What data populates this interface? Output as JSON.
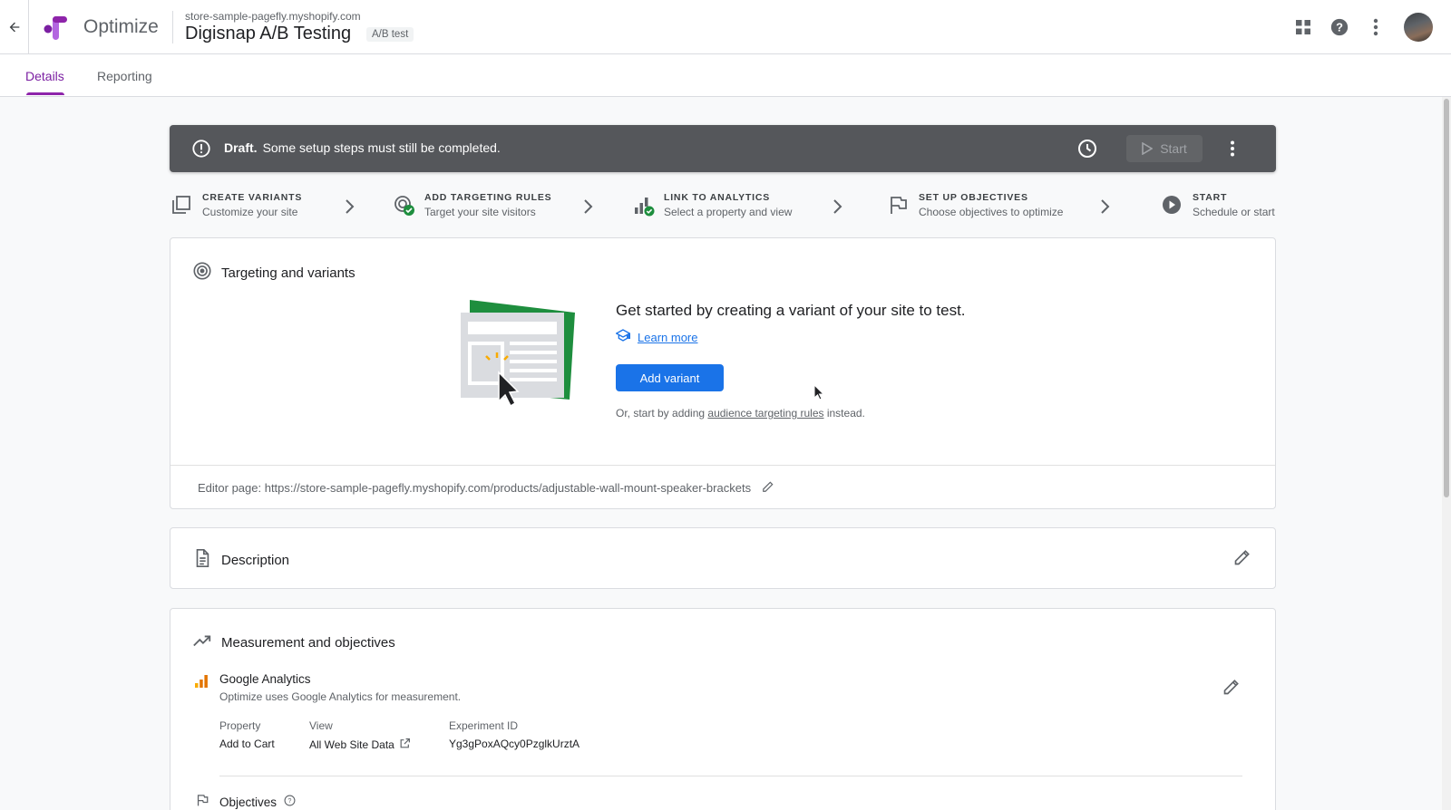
{
  "header": {
    "brand": "Optimize",
    "store_url": "store-sample-pagefly.myshopify.com",
    "experiment_title": "Digisnap A/B Testing",
    "experiment_type": "A/B test",
    "icons": [
      "back-arrow-icon",
      "apps-grid-icon",
      "help-icon",
      "more-vert-icon",
      "avatar"
    ]
  },
  "tabs": [
    {
      "label": "Details",
      "active": true
    },
    {
      "label": "Reporting",
      "active": false
    }
  ],
  "draft_banner": {
    "status": "Draft.",
    "message": "Some setup steps must still be completed.",
    "start_label": "Start"
  },
  "steps": [
    {
      "title": "CREATE VARIANTS",
      "subtitle": "Customize your site",
      "icon": "variants-icon"
    },
    {
      "title": "ADD TARGETING RULES",
      "subtitle": "Target your site visitors",
      "icon": "target-check-icon"
    },
    {
      "title": "LINK TO ANALYTICS",
      "subtitle": "Select a property and view",
      "icon": "analytics-check-icon"
    },
    {
      "title": "SET UP OBJECTIVES",
      "subtitle": "Choose objectives to optimize",
      "icon": "flag-icon"
    },
    {
      "title": "START",
      "subtitle": "Schedule or start",
      "icon": "play-circle-icon"
    }
  ],
  "targeting": {
    "title": "Targeting and variants",
    "heading": "Get started by creating a variant of your site to test.",
    "learn_more": "Learn more",
    "add_variant": "Add variant",
    "or_prefix": "Or, start by adding",
    "or_link": "audience targeting rules",
    "or_suffix": "instead.",
    "editor_page": "Editor page: https://store-sample-pagefly.myshopify.com/products/adjustable-wall-mount-speaker-brackets"
  },
  "description": {
    "title": "Description"
  },
  "measurement": {
    "title": "Measurement and objectives",
    "ga_title": "Google Analytics",
    "ga_subtitle": "Optimize uses Google Analytics for measurement.",
    "property_label": "Property",
    "property_value": "Add to Cart",
    "view_label": "View",
    "view_value": "All Web Site Data",
    "experiment_id_label": "Experiment ID",
    "experiment_id_value": "Yg3gPoxAQcy0PzglkUrztA",
    "objectives_label": "Objectives"
  },
  "colors": {
    "accent_purple": "#8e24aa",
    "primary_blue": "#1a73e8",
    "banner_gray": "#55575b",
    "success_green": "#1e8e3e"
  }
}
